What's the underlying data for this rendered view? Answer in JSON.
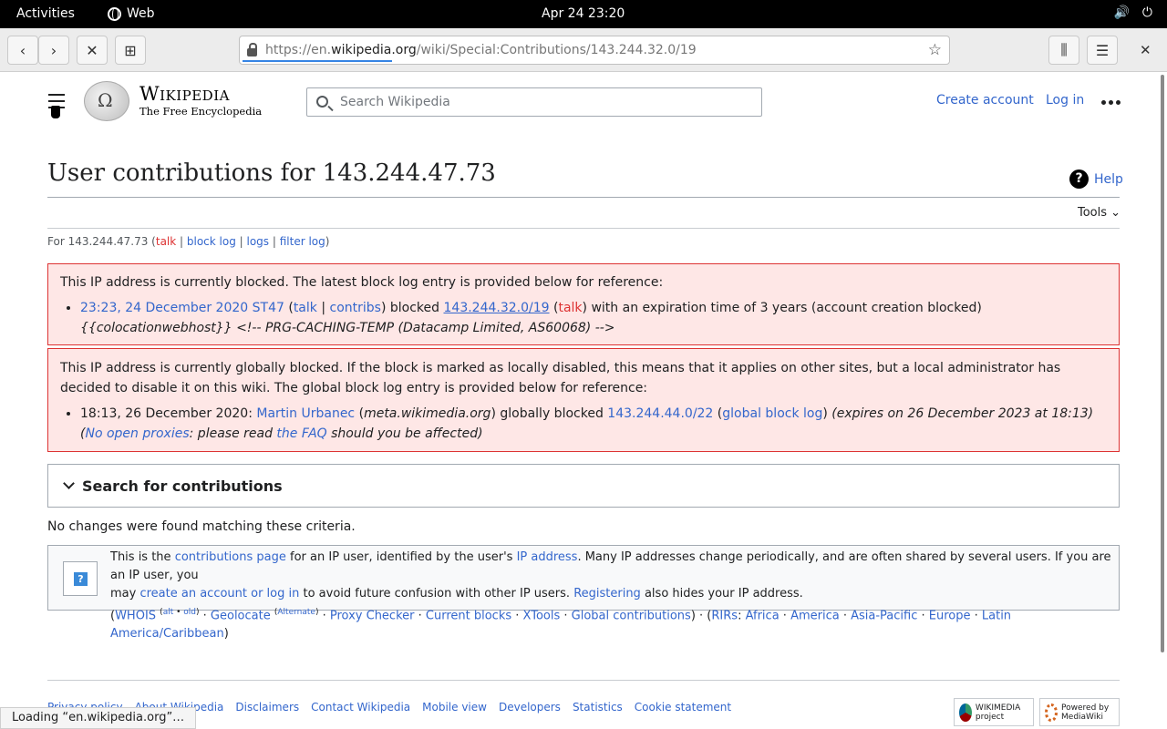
{
  "os": {
    "activities": "Activities",
    "app_name": "Web",
    "clock": "Apr 24  23:20"
  },
  "browser": {
    "url_prefix": "https://en.",
    "url_domain": "wikipedia.org",
    "url_path": "/wiki/Special:Contributions/143.244.32.0/19",
    "status": "Loading “en.wikipedia.org”…"
  },
  "header": {
    "wordmark": "Wikipedia",
    "tagline": "The Free Encyclopedia",
    "search_placeholder": "Search Wikipedia",
    "create_account": "Create account",
    "log_in": "Log in"
  },
  "page": {
    "title": "User contributions for 143.244.47.73",
    "help": "Help",
    "tools": "Tools",
    "sub_prefix": "For 143.244.47.73 (",
    "sub_talk": "talk",
    "sub_block_log": "block log",
    "sub_logs": "logs",
    "sub_filter_log": "filter log",
    "no_changes": "No changes were found matching these criteria."
  },
  "block_local": {
    "intro": "This IP address is currently blocked. The latest block log entry is provided below for reference:",
    "time": "23:23, 24 December 2020 ST47",
    "talk": "talk",
    "contribs": "contribs",
    "blocked": "blocked",
    "range": "143.244.32.0/19",
    "range_talk": "talk",
    "expiry": "with an expiration time of 3 years (account creation blocked)",
    "reason": "{{colocationwebhost}} <!-- PRG-CACHING-TEMP (Datacamp Limited, AS60068) -->"
  },
  "block_global": {
    "intro": "This IP address is currently globally blocked. If the block is marked as locally disabled, this means that it applies on other sites, but a local administrator has decided to disable it on this wiki. The global block log entry is provided below for reference:",
    "time": "18:13, 26 December 2020:",
    "admin": "Martin Urbanec",
    "admin_wiki": "meta.wikimedia.org",
    "action": "globally blocked",
    "range": "143.244.44.0/22",
    "log_link": "global block log",
    "expires": "(expires on 26 December 2023 at 18:13)",
    "reason_link": "No open proxies",
    "reason_rest": ": please read",
    "faq": "the FAQ",
    "tail": "should you be affected)"
  },
  "search_section": {
    "label": "Search for contributions"
  },
  "info": {
    "line1_a": "This is the",
    "contrib_page": "contributions page",
    "line1_b": "for an IP user, identified by the user's",
    "ip_address": "IP address",
    "line1_c": ". Many IP addresses change periodically, and are often shared by several users. If you are an IP user, you",
    "line2_a": "may",
    "create_login": "create an account or log in",
    "line2_b": "to avoid future confusion with other IP users.",
    "registering": "Registering",
    "line2_c": "also hides your IP address.",
    "whois": "WHOIS",
    "alt": "alt",
    "old": "old",
    "geolocate": "Geolocate",
    "alternate": "Alternate",
    "proxy": "Proxy Checker",
    "current_blocks": "Current blocks",
    "xtools": "XTools",
    "global": "Global contributions",
    "rirs": "RIRs",
    "africa": "Africa",
    "america": "America",
    "asia": "Asia-Pacific",
    "europe": "Europe",
    "latam": "Latin America/Caribbean"
  },
  "footer": {
    "links": [
      "Privacy policy",
      "About Wikipedia",
      "Disclaimers",
      "Contact Wikipedia",
      "Mobile view",
      "Developers",
      "Statistics",
      "Cookie statement"
    ],
    "wikimedia": "WIKIMEDIA project",
    "mediawiki": "Powered by MediaWiki"
  }
}
